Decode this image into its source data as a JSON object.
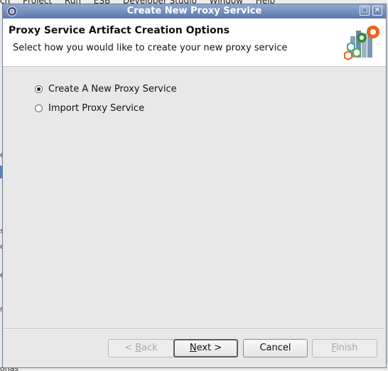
{
  "background_app": {
    "menu_items": [
      "ch",
      "Project",
      "Run",
      "ESB",
      "Developer Studio",
      "Window",
      "Help"
    ],
    "left_edge_glyphs": [
      "e",
      "s",
      "e",
      "e",
      "r"
    ],
    "bottom_text": "ohas"
  },
  "dialog": {
    "title": "Create New Proxy Service",
    "window_buttons": {
      "maximize": "□",
      "close": "✕"
    },
    "header": {
      "heading": "Proxy Service Artifact Creation Options",
      "subheading": "Select how you would like to create your new proxy service"
    },
    "options": [
      {
        "label": "Create A New Proxy Service",
        "checked": true
      },
      {
        "label": "Import Proxy Service",
        "checked": false
      }
    ],
    "buttons": {
      "back": {
        "prefix": "< ",
        "mnemonic": "B",
        "rest": "ack",
        "enabled": false
      },
      "next": {
        "mnemonic": "N",
        "rest": "ext >",
        "enabled": true
      },
      "cancel": {
        "label": "Cancel",
        "enabled": true
      },
      "finish": {
        "mnemonic": "F",
        "rest": "inish",
        "enabled": false
      }
    }
  },
  "colors": {
    "titlebar_start": "#8fa8cf",
    "titlebar_end": "#5b78ab",
    "dialog_bg": "#e8e8e8",
    "header_bg": "#ffffff"
  },
  "icons": {
    "app_icon": "gear-icon",
    "wizard_icon": "proxy-service-wizard-icon"
  }
}
